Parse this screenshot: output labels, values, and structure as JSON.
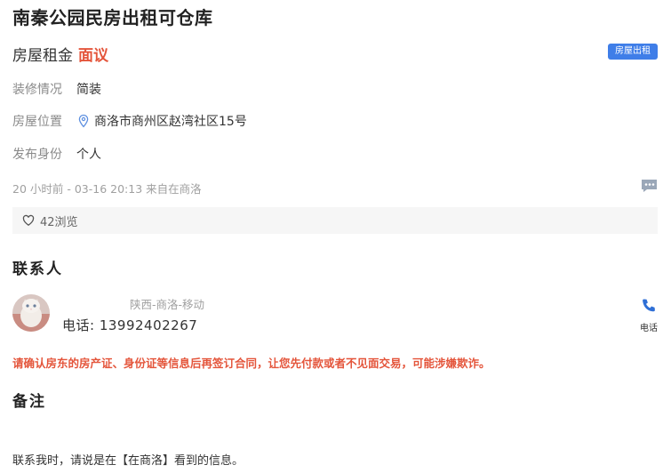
{
  "listing": {
    "title": "南秦公园民房出租可仓库",
    "rent_label": "房屋租金",
    "rent_value": "面议",
    "type_badge": "房屋出租"
  },
  "details": [
    {
      "key": "装修情况",
      "value": "简装"
    },
    {
      "key": "房屋位置",
      "value": "商洛市商州区赵湾社区15号",
      "icon": "location-pin-icon"
    },
    {
      "key": "发布身份",
      "value": "个人"
    }
  ],
  "meta": {
    "posted": "20 小时前 - 03-16 20:13 来自在商洛",
    "message_icon": "chat-bubble-icon"
  },
  "stats": {
    "views": "42浏览",
    "icon": "heart-icon"
  },
  "contact": {
    "heading": "联系人",
    "region": "陕西-商洛-移动",
    "phone": "电话: 13992402267",
    "call_label": "电话",
    "call_icon": "phone-icon",
    "warning": "请确认房东的房产证、身份证等信息后再签订合同，让您先付款或者不见面交易，可能涉嫌欺诈。"
  },
  "remarks": {
    "heading": "备注",
    "text": "联系我时，请说是在【在商洛】看到的信息。"
  },
  "colors": {
    "accent": "#3f7ee8",
    "price": "#e4553b",
    "muted": "#a0a0a0",
    "panel": "#f6f6f6"
  }
}
